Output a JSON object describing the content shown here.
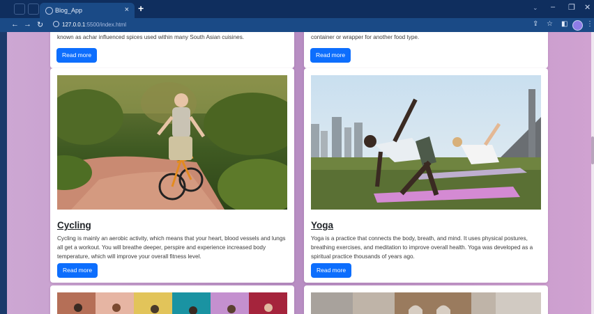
{
  "browser": {
    "tab_title": "Blog_App",
    "tab_close": "×",
    "new_tab": "+",
    "url_host": "127.0.0.1",
    "url_path": ":5500/index.html",
    "icons": [
      "back-icon",
      "forward-icon",
      "reload-icon",
      "info-icon",
      "share-icon",
      "star-icon",
      "sidebar-icon",
      "profile-icon",
      "menu-icon"
    ]
  },
  "cards_top": [
    {
      "text": "known as achar influenced spices used within many South Asian cuisines.",
      "button": "Read more"
    },
    {
      "text": "container or wrapper for another food type.",
      "button": "Read more"
    }
  ],
  "cards": [
    {
      "title": "Cycling",
      "text": "Cycling is mainly an aerobic activity, which means that your heart, blood vessels and lungs all get a workout. You will breathe deeper, perspire and experience increased body temperature, which will improve your overall fitness level.",
      "button": "Read more"
    },
    {
      "title": "Yoga",
      "text": "Yoga is a practice that connects the body, breath, and mind. It uses physical postures, breathing exercises, and meditation to improve overall health. Yoga was developed as a spiritual practice thousands of years ago.",
      "button": "Read more"
    }
  ],
  "colors": {
    "accent": "#0d6efd",
    "page_bg": "#c9a3d1",
    "chrome": "#0f2e5e"
  }
}
